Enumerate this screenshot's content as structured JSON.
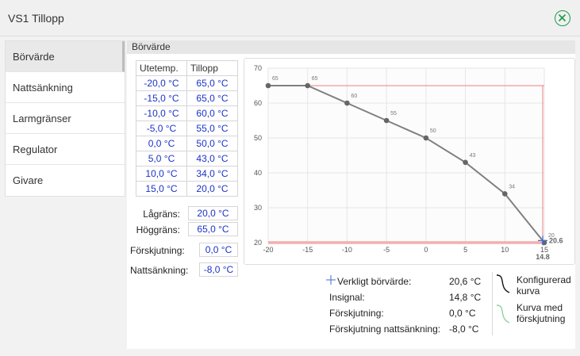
{
  "window": {
    "title": "VS1 Tillopp"
  },
  "sidebar": {
    "items": [
      {
        "label": "Börvärde"
      },
      {
        "label": "Nattsänkning"
      },
      {
        "label": "Larmgränser"
      },
      {
        "label": "Regulator"
      },
      {
        "label": "Givare"
      }
    ]
  },
  "section": {
    "title": "Börvärde"
  },
  "table": {
    "headers": [
      "Utetemp.",
      "Tillopp"
    ],
    "rows": [
      [
        "-20,0 °C",
        "65,0 °C"
      ],
      [
        "-15,0 °C",
        "65,0 °C"
      ],
      [
        "-10,0 °C",
        "60,0 °C"
      ],
      [
        "-5,0 °C",
        "55,0 °C"
      ],
      [
        "0,0 °C",
        "50,0 °C"
      ],
      [
        "5,0 °C",
        "43,0 °C"
      ],
      [
        "10,0 °C",
        "34,0 °C"
      ],
      [
        "15,0 °C",
        "20,0 °C"
      ]
    ]
  },
  "limits": {
    "low_label": "Lågräns:",
    "low_value": "20,0 °C",
    "high_label": "Höggräns:",
    "high_value": "65,0 °C"
  },
  "offsets": {
    "shift_label": "Förskjutning:",
    "shift_value": "0,0 °C",
    "night_label": "Nattsänkning:",
    "night_value": "-8,0 °C"
  },
  "chart_data": {
    "type": "line",
    "x": [
      -20,
      -15,
      -10,
      -5,
      0,
      5,
      10,
      15
    ],
    "series": [
      {
        "values": [
          65,
          65,
          60,
          55,
          50,
          43,
          34,
          20
        ],
        "point_labels": [
          "65",
          "65",
          "60",
          "55",
          "50",
          "43",
          "34",
          "20"
        ]
      }
    ],
    "xlim": [
      -20,
      15
    ],
    "ylim": [
      20,
      70
    ],
    "xticks": [
      "-20",
      "-15",
      "-10",
      "-5",
      "0",
      "5",
      "10",
      "15"
    ],
    "yticks": [
      "20",
      "30",
      "40",
      "50",
      "60",
      "70"
    ],
    "high_limit": 65,
    "low_limit": 20,
    "marker": {
      "x": 14.8,
      "y": 20.6,
      "x_label": "14.8",
      "y_label": "20.6"
    },
    "grid": true,
    "colors": {
      "curve": "#808080",
      "limit": "#f08080",
      "marker": "#3b6fd4",
      "grid": "#e6e6e6"
    }
  },
  "legend": {
    "actual_label": "Verkligt börvärde:",
    "actual_value": "20,6 °C",
    "input_label": "Insignal:",
    "input_value": "14,8 °C",
    "shift_label": "Förskjutning:",
    "shift_value": "0,0 °C",
    "night_label": "Förskjutning nattsänkning:",
    "night_value": "-8,0 °C",
    "configured_label_1": "Konfigurerad",
    "configured_label_2": "kurva",
    "shifted_label_1": "Kurva med",
    "shifted_label_2": "förskjutning",
    "colors": {
      "configured": "#111111",
      "shifted": "#8fd19e",
      "marker": "#3b6fd4"
    }
  }
}
